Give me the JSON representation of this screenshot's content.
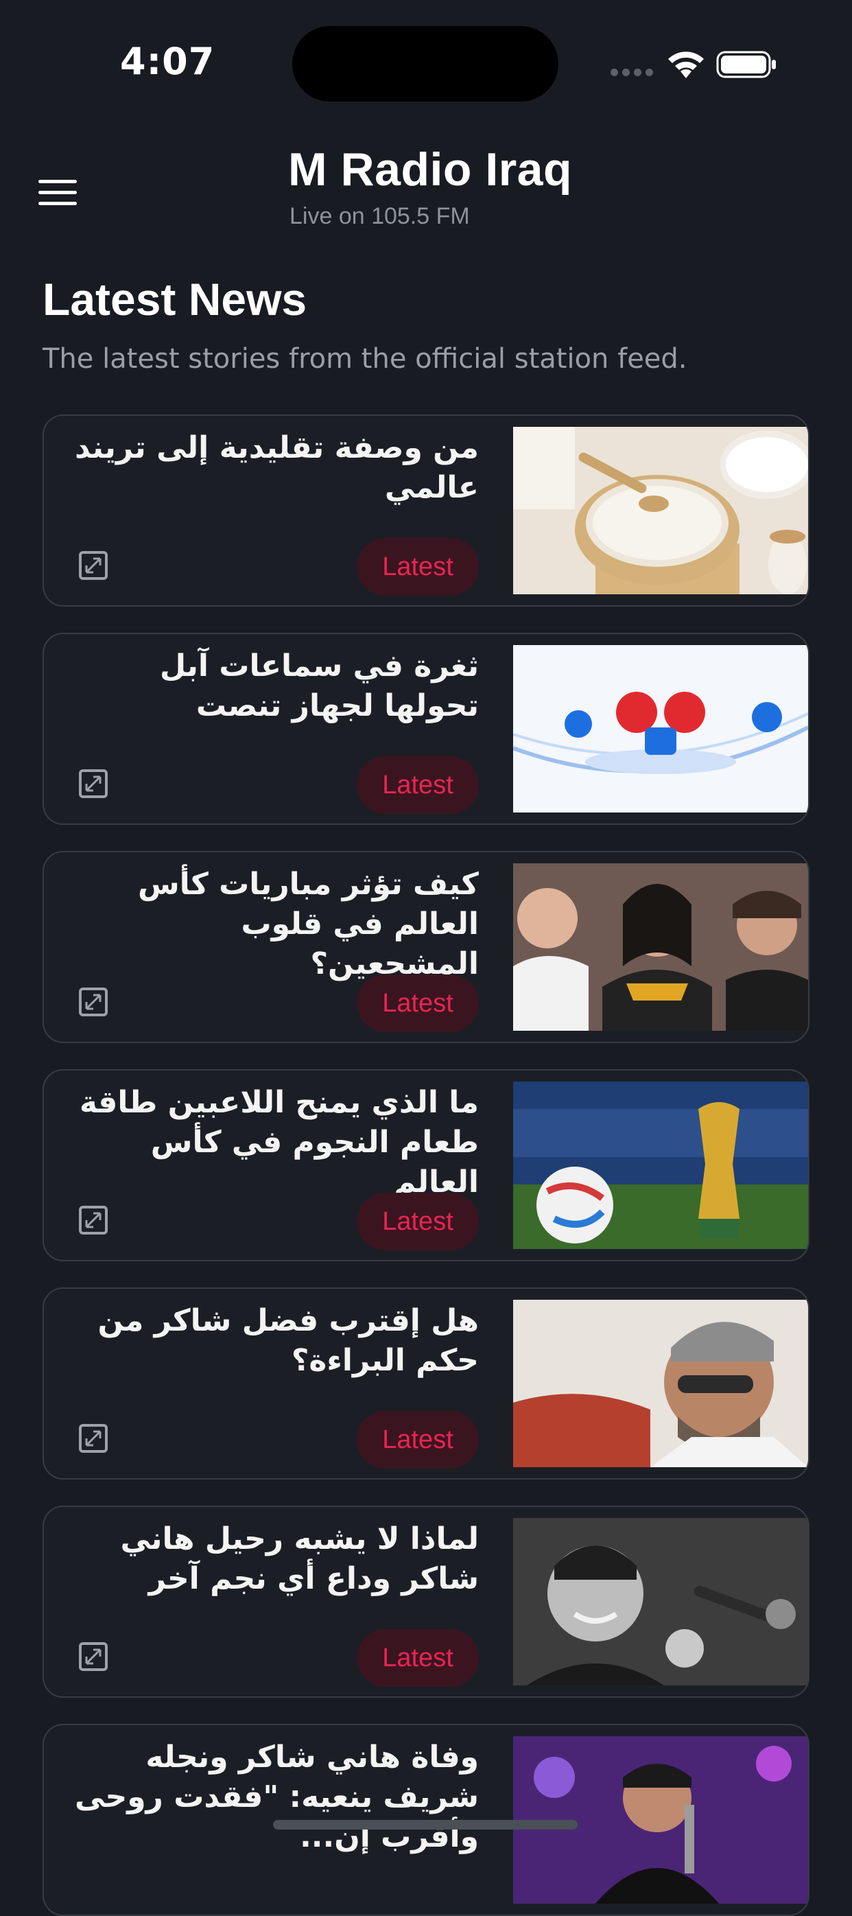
{
  "status_bar": {
    "time": "4:07"
  },
  "header": {
    "title": "M Radio Iraq",
    "subtitle": "Live on 105.5 FM"
  },
  "section": {
    "title": "Latest News",
    "description": "The latest stories from the official station feed."
  },
  "badge_label": "Latest",
  "news": [
    {
      "title": "من وصفة تقليدية إلى تريند عالمي",
      "image": "rice-water-bowl"
    },
    {
      "title": "ثغرة في سماعات آبل  تحولها لجهاز تنصت",
      "image": "apple-beats-security"
    },
    {
      "title": "كيف تؤثر مباريات كأس العالم في قلوب المشجعين؟",
      "image": "football-fans-crowd"
    },
    {
      "title": "ما الذي يمنح اللاعبين طاقة طعام النجوم في كأس العالم",
      "image": "world-cup-trophy-ball"
    },
    {
      "title": "هل إقترب فضل شاكر من حكم البراءة؟",
      "image": "singer-portrait-sunglasses"
    },
    {
      "title": "لماذا لا يشبه رحيل هاني شاكر وداع أي نجم آخر",
      "image": "singer-microphone-bw"
    },
    {
      "title": "وفاة هاني شاكر ونجله شريف ينعيه: \"فقدت روحى وأقرب إن...",
      "image": "singer-on-stage"
    }
  ]
}
